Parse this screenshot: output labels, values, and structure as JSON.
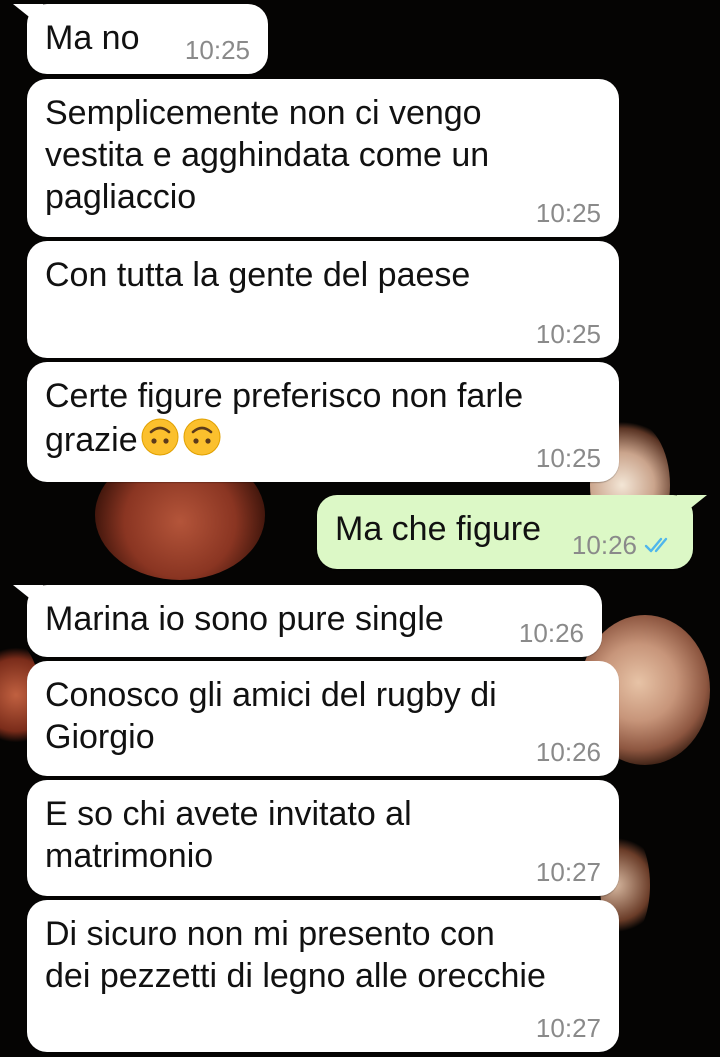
{
  "messages": [
    {
      "text": "Ma no",
      "time": "10:25"
    },
    {
      "text": "Semplicemente non ci vengo\nvestita e agghindata come un\npagliaccio",
      "time": "10:25"
    },
    {
      "text": "Con tutta la gente del paese",
      "time": "10:25"
    },
    {
      "text": "Certe figure preferisco non farle\ngrazie",
      "time": "10:25",
      "emojis": [
        "upside-down-face",
        "upside-down-face"
      ]
    },
    {
      "text": "Ma che figure",
      "time": "10:26",
      "status": "read-double-tick"
    },
    {
      "text": "Marina io sono pure single",
      "time": "10:26"
    },
    {
      "text": "Conosco gli amici del rugby di\nGiorgio",
      "time": "10:26"
    },
    {
      "text": "E so chi avete invitato al\nmatrimonio",
      "time": "10:27"
    },
    {
      "text": "Di sicuro non mi presento con\ndei pezzetti di legno alle orecchie",
      "time": "10:27"
    }
  ],
  "colors": {
    "incoming_bubble": "#ffffff",
    "outgoing_bubble": "#dcf8c6",
    "timestamp": "#8a8a8a",
    "read_tick": "#4fb6ec",
    "background": "#050403"
  }
}
